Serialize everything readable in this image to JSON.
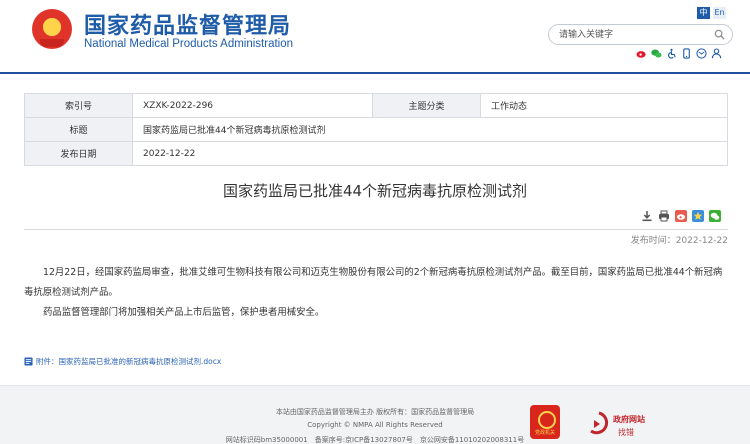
{
  "header": {
    "title_cn": "国家药品监督管理局",
    "title_en": "National Medical Products Administration",
    "lang_cn": "中",
    "lang_en": "En",
    "search_placeholder": "请输入关键字",
    "share_icons": [
      "weibo-icon",
      "wechat-icon",
      "accessibility-icon",
      "mobile-icon",
      "email-icon",
      "user-icon"
    ]
  },
  "meta": {
    "index_label": "索引号",
    "index_value": "XZXK-2022-296",
    "category_label": "主题分类",
    "category_value": "工作动态",
    "title_label": "标题",
    "title_value": "国家药监局已批准44个新冠病毒抗原检测试剂",
    "date_label": "发布日期",
    "date_value": "2022-12-22"
  },
  "article": {
    "title": "国家药监局已批准44个新冠病毒抗原检测试剂",
    "pub_date": "发布时间：2022-12-22",
    "paragraphs": [
      "12月22日，经国家药监局审查，批准艾维可生物科技有限公司和迈克生物股份有限公司的2个新冠病毒抗原检测试剂产品。截至目前，国家药监局已批准44个新冠病毒抗原检测试剂产品。",
      "药品监督管理部门将加强相关产品上市后监管，保护患者用械安全。"
    ],
    "attachment": "附件：国家药监局已批准的新冠病毒抗原检测试剂.docx",
    "tools": [
      "download-icon",
      "print-icon",
      "weibo-share-icon",
      "qzone-share-icon",
      "wechat-share-icon"
    ]
  },
  "footer": {
    "line1": "本站由国家药品监督管理局主办 版权所有：国家药品监督管理局",
    "line2": "Copyright © NMPA All Rights Reserved",
    "line3": "网站标识码bm35000001　备案序号:京ICP备13027807号　京公网安备11010202008311号",
    "party_badge": "党政机关",
    "gov_find_1": "政府网站",
    "gov_find_2": "找错"
  },
  "colors": {
    "brand_blue": "#1f5ca8",
    "link_blue": "#2a63b4",
    "red": "#c0272d"
  }
}
